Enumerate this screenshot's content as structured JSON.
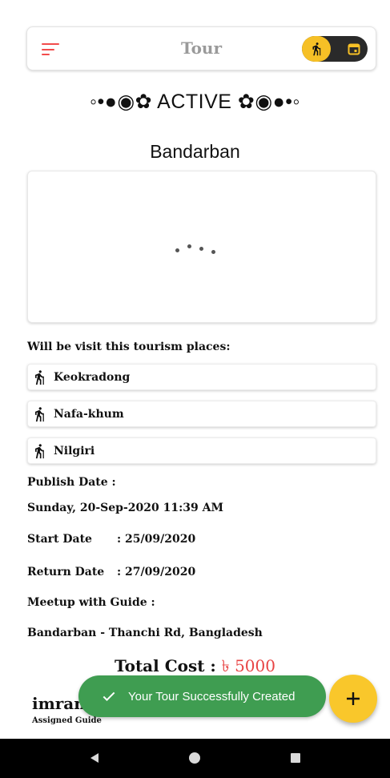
{
  "appbar": {
    "title": "Tour",
    "menu_icon": "menu-icon",
    "toggle": {
      "active_icon": "hiking-icon",
      "inactive_icon": "calendar-icon",
      "knob_color": "#f6c026"
    }
  },
  "tour": {
    "status": "◦•●◉✿ ACTIVE ✿◉●•◦",
    "location": "Bandarban",
    "places_label": "Will be visit this tourism places:",
    "places": [
      {
        "label": "Keokradong",
        "icon": "hiking-icon"
      },
      {
        "label": "Nafa-khum",
        "icon": "hiking-icon"
      },
      {
        "label": "Nilgiri",
        "icon": "hiking-icon"
      }
    ],
    "publish_date_label": "Publish Date     :",
    "publish_date_value": "Sunday, 20-Sep-2020 11:39 AM",
    "start_date_label": "Start Date",
    "start_date_value": ": 25/09/2020",
    "return_date_label": "Return Date",
    "return_date_value": ": 27/09/2020",
    "meetup_label": "Meetup with Guide  :",
    "meetup_value": "Bandarban - Thanchi Rd, Bangladesh",
    "total_label": "Total Cost : ",
    "total_amount": "৳ 5000"
  },
  "guide": {
    "name": "imran",
    "role": "Assigned Guide"
  },
  "toast": {
    "message": "Your Tour Successfully Created",
    "color": "#3f9d51"
  },
  "fab": {
    "icon": "plus-icon",
    "color": "#f9c72b"
  },
  "colors": {
    "accent": "#f24c4c",
    "amount": "#e84444",
    "title": "#9a9a9a"
  }
}
